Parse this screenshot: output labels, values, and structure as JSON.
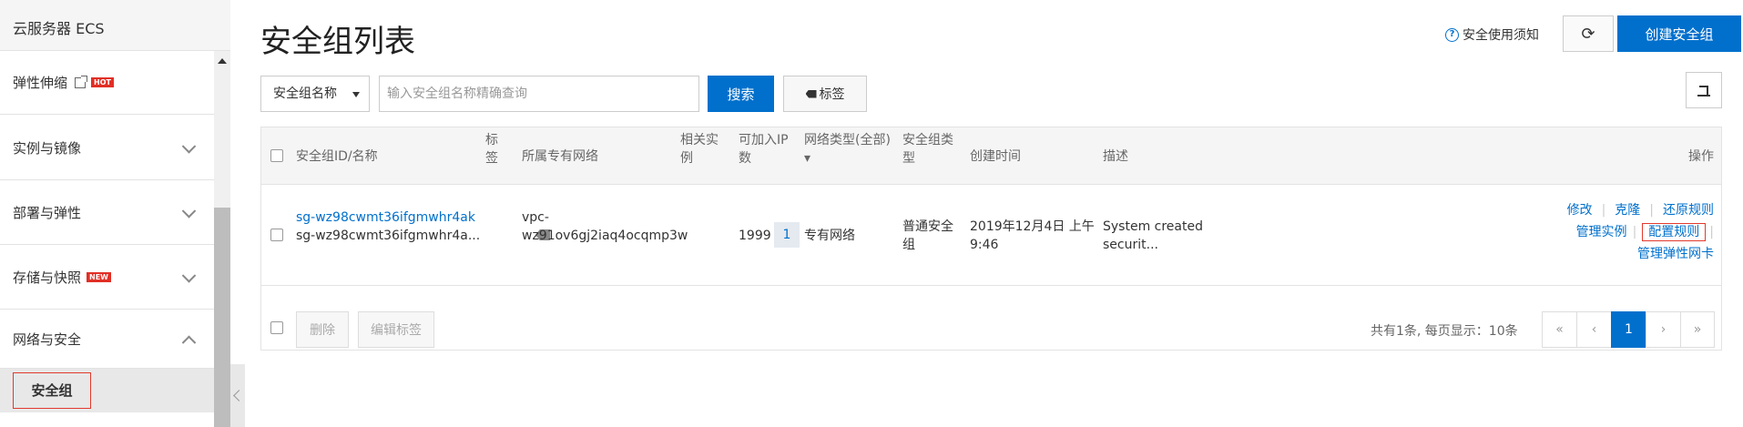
{
  "sidebar": {
    "title": "云服务器 ECS",
    "items": [
      {
        "label": "弹性伸缩",
        "badge": "HOT",
        "external": true
      },
      {
        "label": "实例与镜像",
        "expanded": false
      },
      {
        "label": "部署与弹性",
        "expanded": false
      },
      {
        "label": "存储与快照",
        "badge": "NEW",
        "expanded": false
      },
      {
        "label": "网络与安全",
        "expanded": true
      }
    ],
    "sub_item": "安全组"
  },
  "header": {
    "title": "安全组列表",
    "notice": "安全使用须知",
    "refresh_icon": "⟳",
    "create_label": "创建安全组"
  },
  "filter": {
    "select_value": "安全组名称",
    "placeholder": "输入安全组名称精确查询",
    "search_label": "搜索",
    "tag_label": "标签"
  },
  "table": {
    "columns": [
      "安全组ID/名称",
      "标签",
      "所属专有网络",
      "相关实例",
      "可加入IP数",
      "网络类型(全部)",
      "安全组类型",
      "创建时间",
      "描述",
      "操作"
    ],
    "columns_wrapped": {
      "tag": [
        "标",
        "签"
      ],
      "related": [
        "相关实",
        "例"
      ],
      "ip": [
        "可加入IP",
        "数"
      ],
      "net_type": [
        "网络类型(全部)",
        "▾"
      ],
      "sg_type": [
        "安全组类",
        "型"
      ]
    },
    "rows": [
      {
        "id": "sg-wz98cwmt36ifgmwhr4ak",
        "name": "sg-wz98cwmt36ifgmwhr4a...",
        "vpc_line1": "vpc-",
        "vpc_line2": "wz91ov6gj2iaq4ocqmp3w",
        "instances": "1",
        "ip_count": "1999",
        "network_type": "专有网络",
        "sg_type_line1": "普通安全",
        "sg_type_line2": "组",
        "created_line1": "2019年12月4日 上午",
        "created_line2": "9:46",
        "desc_line1": "System created",
        "desc_line2": "securit...",
        "ops": {
          "modify": "修改",
          "clone": "克隆",
          "restore": "还原规则",
          "manage_instances": "管理实例",
          "config_rules": "配置规则",
          "manage_eni": "管理弹性网卡"
        }
      }
    ]
  },
  "footer": {
    "delete_label": "删除",
    "edit_tags_label": "编辑标签",
    "page_info": "共有1条, 每页显示：10条",
    "pager": {
      "first": "«",
      "prev": "‹",
      "current": "1",
      "next": "›",
      "last": "»"
    }
  }
}
